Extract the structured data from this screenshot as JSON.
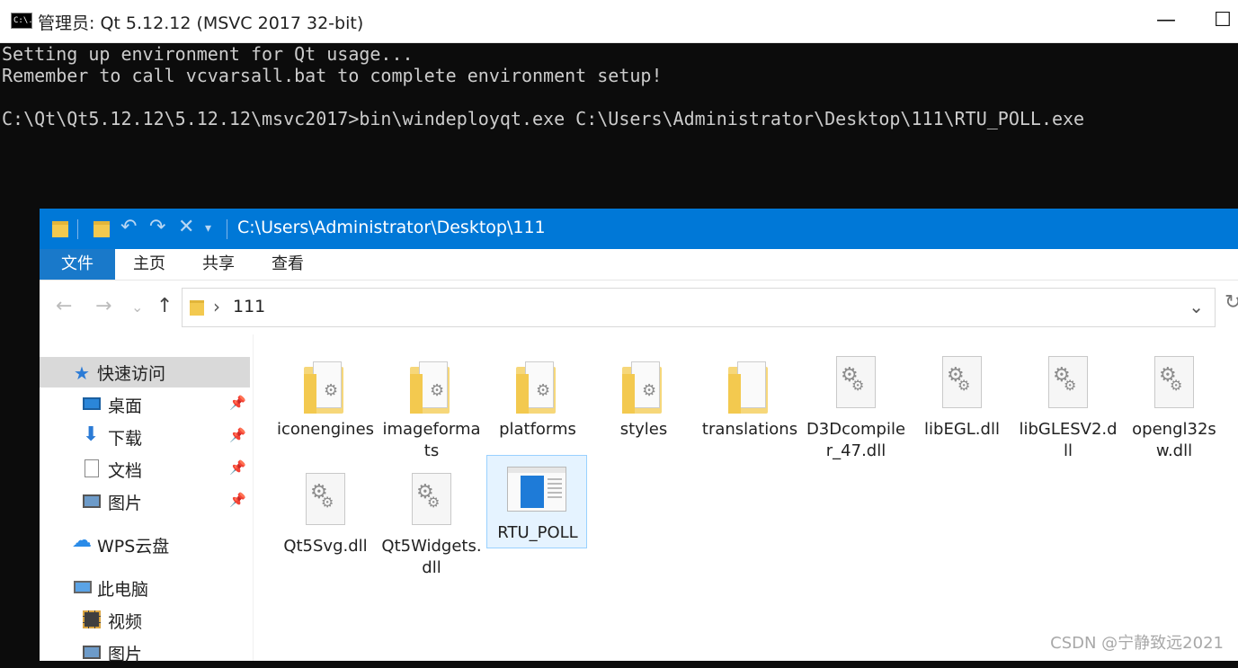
{
  "cmd": {
    "title": "管理员: Qt 5.12.12 (MSVC 2017 32-bit)",
    "icon_text": "C:\\.",
    "lines": [
      "Setting up environment for Qt usage...",
      "Remember to call vcvarsall.bat to complete environment setup!",
      "",
      "C:\\Qt\\Qt5.12.12\\5.12.12\\msvc2017>bin\\windeployqt.exe C:\\Users\\Administrator\\Desktop\\111\\RTU_POLL.exe"
    ],
    "min_glyph": "—",
    "max_glyph": "☐"
  },
  "explorer": {
    "title_path": "C:\\Users\\Administrator\\Desktop\\111",
    "ribbon_tabs": [
      "文件",
      "主页",
      "共享",
      "查看"
    ],
    "address": {
      "crumb": "111",
      "chevron": "›",
      "dropdown": "⌄"
    },
    "nav": {
      "back": "←",
      "forward": "→",
      "recent": "⌄",
      "up": "↑",
      "refresh": "↻"
    },
    "sidebar": [
      {
        "label": "快速访问",
        "icon": "star-icon",
        "pinned": false,
        "selected": true
      },
      {
        "label": "桌面",
        "icon": "desktop-icon",
        "pinned": true
      },
      {
        "label": "下载",
        "icon": "download-icon",
        "pinned": true
      },
      {
        "label": "文档",
        "icon": "document-icon",
        "pinned": true
      },
      {
        "label": "图片",
        "icon": "picture-icon",
        "pinned": true
      },
      {
        "label": "WPS云盘",
        "icon": "cloud-icon",
        "pinned": false
      },
      {
        "label": "此电脑",
        "icon": "computer-icon",
        "pinned": false
      },
      {
        "label": "视频",
        "icon": "video-icon",
        "pinned": false
      },
      {
        "label": "图片",
        "icon": "picture-icon",
        "pinned": false
      }
    ],
    "files": [
      {
        "name": "iconengines",
        "type": "folder"
      },
      {
        "name": "imageformats",
        "type": "folder"
      },
      {
        "name": "platforms",
        "type": "folder"
      },
      {
        "name": "styles",
        "type": "folder"
      },
      {
        "name": "translations",
        "type": "folder"
      },
      {
        "name": "D3Dcompiler_47.dll",
        "type": "dll"
      },
      {
        "name": "libEGL.dll",
        "type": "dll"
      },
      {
        "name": "libGLESV2.dll",
        "type": "dll"
      },
      {
        "name": "opengl32sw.dll",
        "type": "dll"
      },
      {
        "name": "Qt5Svg.dll",
        "type": "dll"
      },
      {
        "name": "Qt5Widgets.dll",
        "type": "dll"
      },
      {
        "name": "RTU_POLL",
        "type": "exe",
        "selected": true
      }
    ]
  },
  "watermark": "CSDN @宁静致远2021",
  "colors": {
    "accent": "#0078d7",
    "console_bg": "#0c0c0c",
    "console_fg": "#cccccc"
  }
}
